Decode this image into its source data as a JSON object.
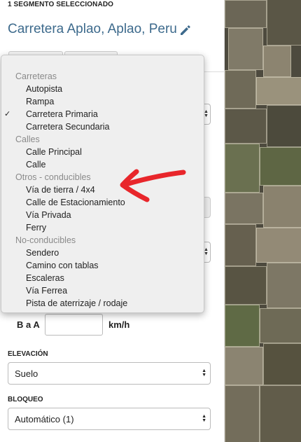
{
  "panel": {
    "selection_header": "1 SEGMENTO SELECCIONADO",
    "street_title": "Carretera Aplao, Aplao, Peru",
    "speed": {
      "direction_label": "B a A",
      "value": "",
      "unit": "km/h"
    },
    "elevation": {
      "label": "ELEVACIÓN",
      "value": "Suelo"
    },
    "lock": {
      "label": "BLOQUEO",
      "value": "Automático (1)"
    }
  },
  "road_type_dropdown": {
    "selected": "Carretera Primaria",
    "groups": [
      {
        "label": "Carreteras",
        "options": [
          "Autopista",
          "Rampa",
          "Carretera Primaria",
          "Carretera Secundaria"
        ]
      },
      {
        "label": "Calles",
        "options": [
          "Calle Principal",
          "Calle"
        ]
      },
      {
        "label": "Otros - conducibles",
        "options": [
          "Vía de tierra / 4x4",
          "Calle de Estacionamiento",
          "Vía Privada",
          "Ferry"
        ]
      },
      {
        "label": "No-conducibles",
        "options": [
          "Sendero",
          "Camino con tablas",
          "Escaleras",
          "Vía Ferrea",
          "Pista de aterrizaje / rodaje"
        ]
      }
    ],
    "check_mark": "✓"
  },
  "annotation": {
    "color": "#e8262b"
  },
  "colors": {
    "title": "#3d6a8c",
    "map_base": "#4d4a3e"
  }
}
